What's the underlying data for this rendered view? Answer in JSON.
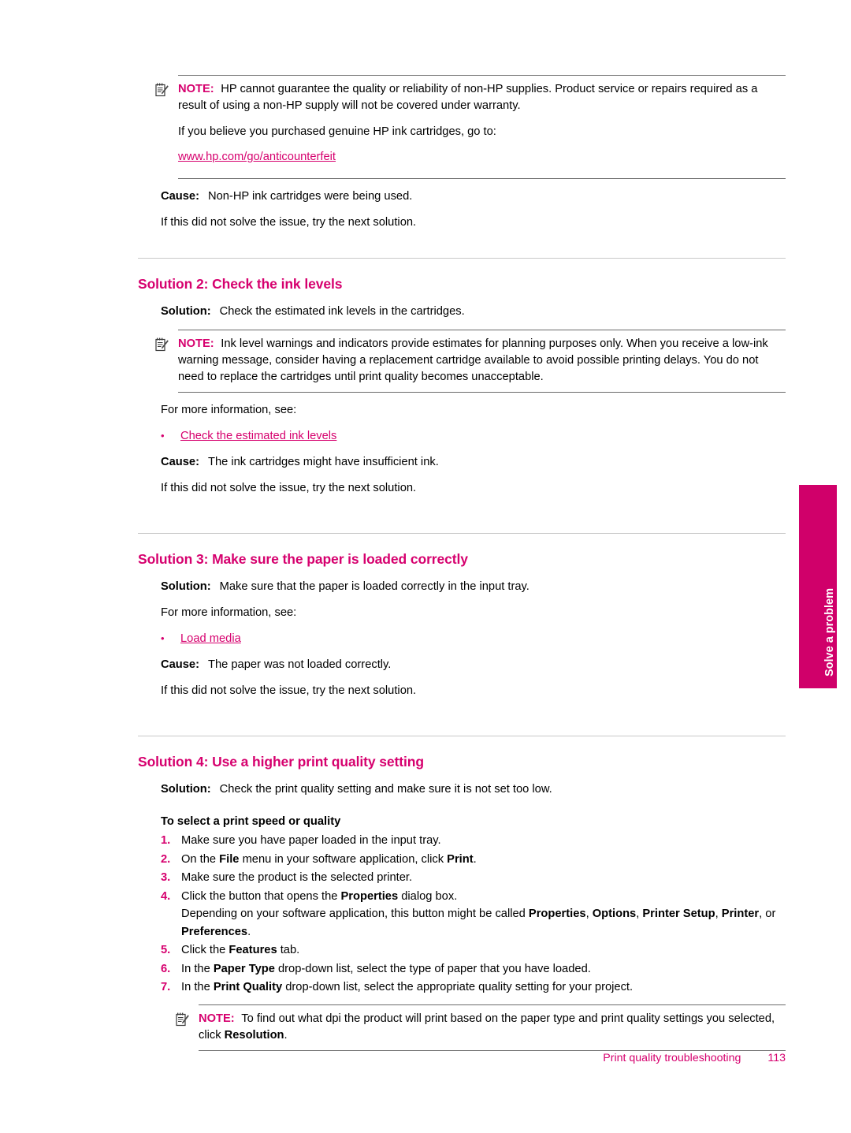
{
  "document": {
    "footer_title": "Print quality troubleshooting",
    "page_number": "113",
    "side_tab_label": "Solve a problem",
    "accent_color": "#D6006E",
    "tab_color": "#D0006A"
  },
  "note_label": "NOTE:",
  "note_icon_name": "note-pad-pencil-icon",
  "block1": {
    "note_text": "HP cannot guarantee the quality or reliability of non-HP supplies. Product service or repairs required as a result of using a non-HP supply will not be covered under warranty.",
    "note_para2": "If you believe you purchased genuine HP ink cartridges, go to:",
    "note_link": "www.hp.com/go/anticounterfeit",
    "cause_label": "Cause:",
    "cause_text": "Non-HP ink cartridges were being used.",
    "next_text": "If this did not solve the issue, try the next solution."
  },
  "solution2": {
    "heading": "Solution 2: Check the ink levels",
    "solution_label": "Solution:",
    "solution_text": "Check the estimated ink levels in the cartridges.",
    "note_text": "Ink level warnings and indicators provide estimates for planning purposes only. When you receive a low-ink warning message, consider having a replacement cartridge available to avoid possible printing delays. You do not need to replace the cartridges until print quality becomes unacceptable.",
    "more_info": "For more information, see:",
    "links": [
      "Check the estimated ink levels"
    ],
    "cause_label": "Cause:",
    "cause_text": "The ink cartridges might have insufficient ink.",
    "next_text": "If this did not solve the issue, try the next solution."
  },
  "solution3": {
    "heading": "Solution 3: Make sure the paper is loaded correctly",
    "solution_label": "Solution:",
    "solution_text": "Make sure that the paper is loaded correctly in the input tray.",
    "more_info": "For more information, see:",
    "links": [
      "Load media"
    ],
    "cause_label": "Cause:",
    "cause_text": "The paper was not loaded correctly.",
    "next_text": "If this did not solve the issue, try the next solution."
  },
  "solution4": {
    "heading": "Solution 4: Use a higher print quality setting",
    "solution_label": "Solution:",
    "solution_text": "Check the print quality setting and make sure it is not set too low.",
    "procedure_title": "To select a print speed or quality",
    "steps": [
      {
        "num": "1.",
        "text": "Make sure you have paper loaded in the input tray."
      },
      {
        "num": "2.",
        "text": "On the File menu in your software application, click Print."
      },
      {
        "num": "3.",
        "text": "Make sure the product is the selected printer."
      },
      {
        "num": "4.",
        "text": "Click the button that opens the Properties dialog box."
      },
      {
        "num": "5.",
        "text": "Click the Features tab."
      },
      {
        "num": "6.",
        "text": "In the Paper Type drop-down list, select the type of paper that you have loaded."
      },
      {
        "num": "7.",
        "text": "In the Print Quality drop-down list, select the appropriate quality setting for your project."
      }
    ],
    "step4_detail": "Depending on your software application, this button might be called Properties, Options, Printer Setup, Printer, or Preferences.",
    "note_text": "To find out what dpi the product will print based on the paper type and print quality settings you selected, click Resolution."
  }
}
